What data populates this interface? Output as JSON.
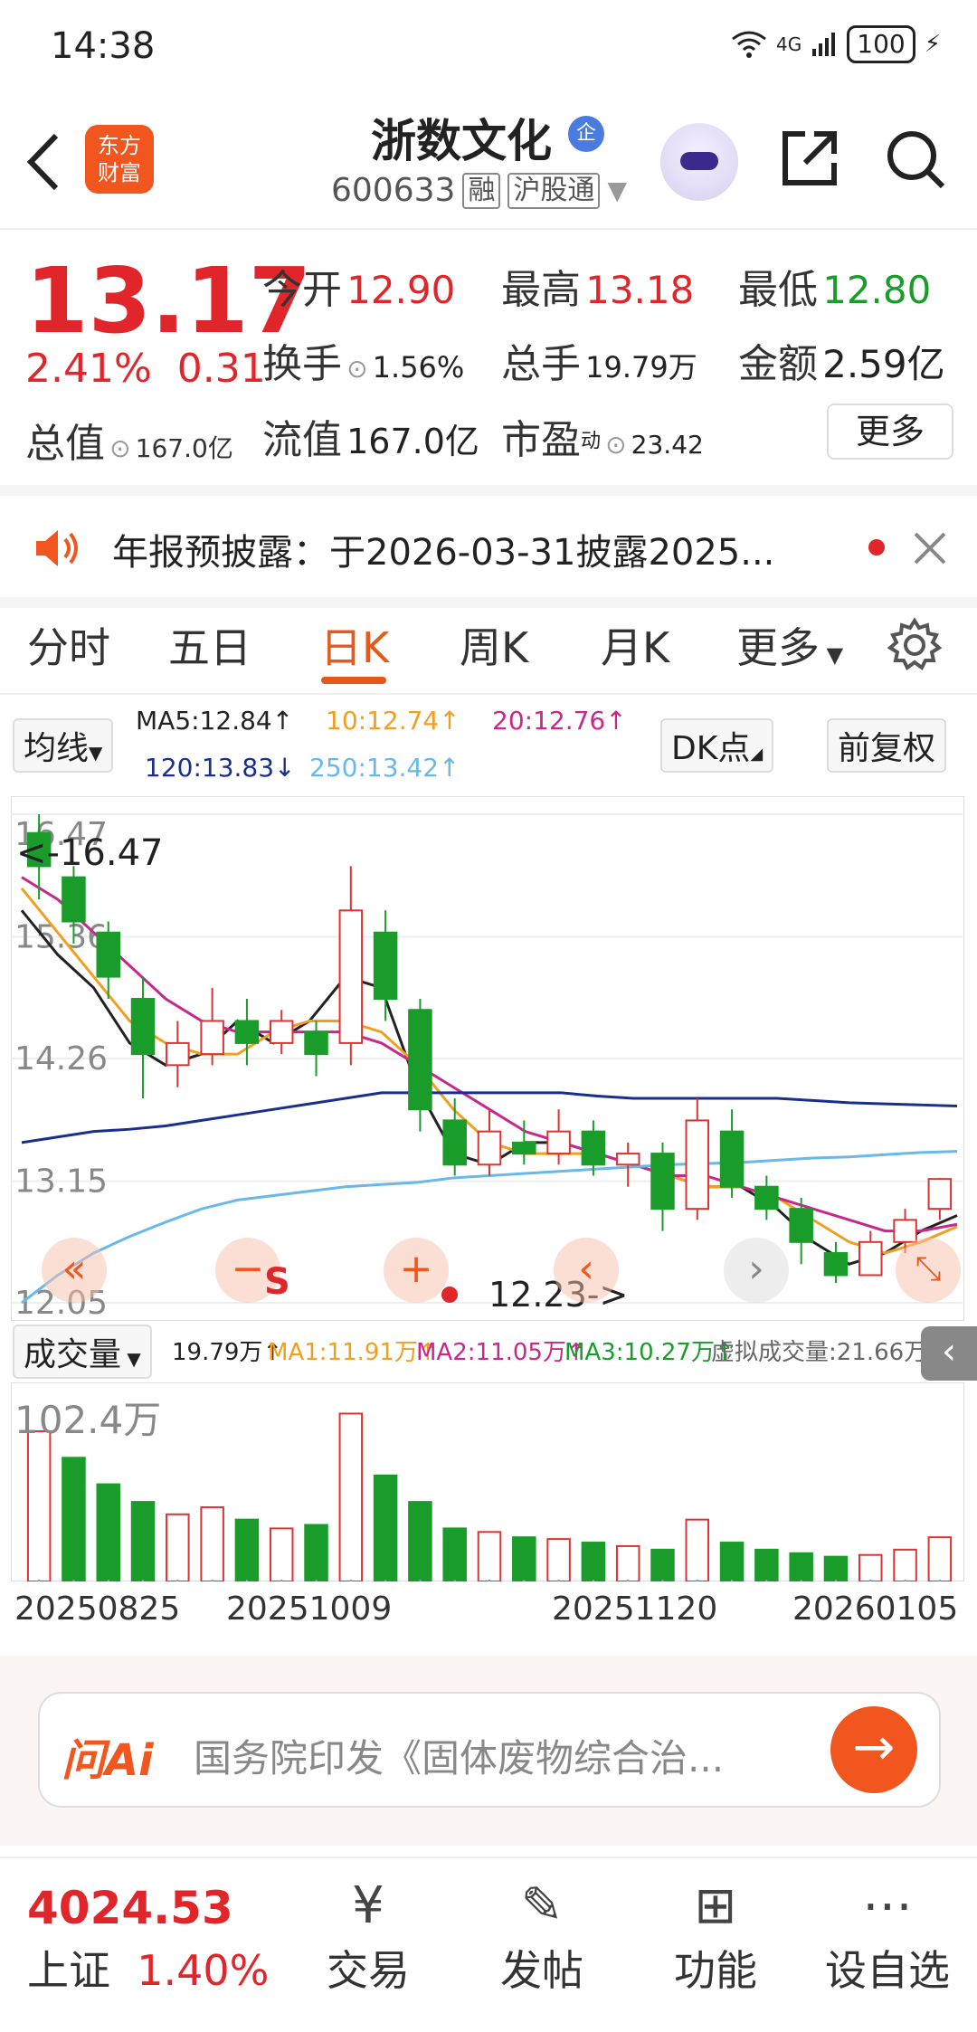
{
  "status": {
    "time": "14:38",
    "network": "4G",
    "battery": "100"
  },
  "header": {
    "logo_line1": "东方",
    "logo_line2": "财富",
    "name": "浙数文化",
    "badge": "企",
    "code": "600633",
    "tag1": "融",
    "tag2": "沪股通"
  },
  "quote": {
    "price": "13.17",
    "chg_pct": "2.41%",
    "chg": "0.31",
    "open_label": "今开",
    "open": "12.90",
    "high_label": "最高",
    "high": "13.18",
    "low_label": "最低",
    "low": "12.80",
    "turnover_label": "换手",
    "turnover": "1.56%",
    "volume_label": "总手",
    "volume": "19.79万",
    "amount_label": "金额",
    "amount": "2.59亿",
    "mktcap_label": "总值",
    "mktcap": "167.0亿",
    "float_label": "流值",
    "float": "167.0亿",
    "pe_label": "市盈",
    "pe_sup": "动",
    "pe": "23.42",
    "more": "更多"
  },
  "notice": {
    "text": "年报预披露：于2026-03-31披露2025..."
  },
  "tabs": [
    "分时",
    "五日",
    "日K",
    "周K",
    "月K",
    "更多"
  ],
  "ma_legend": {
    "btn": "均线",
    "ma5": "MA5:12.84↑",
    "ma10": "10:12.74↑",
    "ma20": "20:12.76↑",
    "ma120": "120:13.83↓",
    "ma250": "250:13.42↑",
    "dk": "DK点",
    "fq": "前复权",
    "colors": {
      "ma5": "#222222",
      "ma10": "#f0a020",
      "ma20": "#c8288c",
      "ma120": "#1a2f8c",
      "ma250": "#6ab8e8"
    }
  },
  "chart_data": {
    "type": "candlestick",
    "y_ticks": [
      "16.47",
      "15.36",
      "14.26",
      "13.15",
      "12.05"
    ],
    "max_label": "<-16.47",
    "min_label": "12.23->",
    "ylim": [
      12.05,
      16.47
    ],
    "series": [
      {
        "name": "MA5",
        "values": [
          15.6,
          15.2,
          14.9,
          14.4,
          14.2,
          14.3,
          14.6,
          14.4,
          14.6,
          15.0,
          14.9,
          14.0,
          13.4,
          13.3,
          13.5,
          13.5,
          13.4,
          13.3,
          13.2,
          13.1,
          13.1,
          12.9,
          12.6,
          12.4,
          12.5,
          12.7,
          12.84
        ]
      },
      {
        "name": "MA10",
        "values": [
          15.8,
          15.4,
          15.0,
          14.6,
          14.4,
          14.3,
          14.3,
          14.5,
          14.6,
          14.6,
          14.5,
          14.2,
          13.8,
          13.5,
          13.4,
          13.4,
          13.4,
          13.3,
          13.2,
          13.1,
          13.1,
          13.0,
          12.8,
          12.6,
          12.5,
          12.6,
          12.74
        ]
      },
      {
        "name": "MA20",
        "values": [
          15.9,
          15.7,
          15.4,
          15.1,
          14.8,
          14.6,
          14.5,
          14.5,
          14.5,
          14.5,
          14.4,
          14.2,
          14.0,
          13.8,
          13.6,
          13.5,
          13.4,
          13.3,
          13.2,
          13.2,
          13.1,
          13.0,
          12.9,
          12.8,
          12.7,
          12.7,
          12.76
        ]
      },
      {
        "name": "MA120",
        "values": [
          13.5,
          13.55,
          13.6,
          13.62,
          13.65,
          13.7,
          13.75,
          13.8,
          13.85,
          13.9,
          13.95,
          13.95,
          13.95,
          13.95,
          13.95,
          13.95,
          13.92,
          13.9,
          13.9,
          13.9,
          13.9,
          13.9,
          13.88,
          13.86,
          13.85,
          13.84,
          13.83
        ]
      },
      {
        "name": "MA250",
        "values": [
          12.05,
          12.3,
          12.5,
          12.65,
          12.78,
          12.9,
          12.98,
          13.02,
          13.06,
          13.1,
          13.12,
          13.14,
          13.18,
          13.2,
          13.22,
          13.24,
          13.26,
          13.28,
          13.3,
          13.31,
          13.32,
          13.34,
          13.36,
          13.37,
          13.39,
          13.41,
          13.42
        ]
      }
    ],
    "candles": [
      {
        "o": 16.3,
        "c": 16.0,
        "h": 16.47,
        "l": 15.7
      },
      {
        "o": 15.9,
        "c": 15.5,
        "h": 16.0,
        "l": 15.3
      },
      {
        "o": 15.4,
        "c": 15.0,
        "h": 15.5,
        "l": 14.8
      },
      {
        "o": 14.8,
        "c": 14.3,
        "h": 15.0,
        "l": 13.9
      },
      {
        "o": 14.2,
        "c": 14.4,
        "h": 14.6,
        "l": 14.0
      },
      {
        "o": 14.3,
        "c": 14.6,
        "h": 14.9,
        "l": 14.2
      },
      {
        "o": 14.6,
        "c": 14.4,
        "h": 14.8,
        "l": 14.2
      },
      {
        "o": 14.4,
        "c": 14.6,
        "h": 14.7,
        "l": 14.3
      },
      {
        "o": 14.5,
        "c": 14.3,
        "h": 14.6,
        "l": 14.1
      },
      {
        "o": 14.4,
        "c": 15.6,
        "h": 16.0,
        "l": 14.2
      },
      {
        "o": 15.4,
        "c": 14.8,
        "h": 15.6,
        "l": 14.6
      },
      {
        "o": 14.7,
        "c": 13.8,
        "h": 14.8,
        "l": 13.6
      },
      {
        "o": 13.7,
        "c": 13.3,
        "h": 13.9,
        "l": 13.2
      },
      {
        "o": 13.3,
        "c": 13.6,
        "h": 13.8,
        "l": 13.2
      },
      {
        "o": 13.5,
        "c": 13.4,
        "h": 13.7,
        "l": 13.3
      },
      {
        "o": 13.4,
        "c": 13.6,
        "h": 13.8,
        "l": 13.3
      },
      {
        "o": 13.6,
        "c": 13.3,
        "h": 13.7,
        "l": 13.2
      },
      {
        "o": 13.3,
        "c": 13.4,
        "h": 13.5,
        "l": 13.1
      },
      {
        "o": 13.4,
        "c": 12.9,
        "h": 13.5,
        "l": 12.7
      },
      {
        "o": 12.9,
        "c": 13.7,
        "h": 13.9,
        "l": 12.8
      },
      {
        "o": 13.6,
        "c": 13.1,
        "h": 13.8,
        "l": 13.0
      },
      {
        "o": 13.1,
        "c": 12.9,
        "h": 13.2,
        "l": 12.8
      },
      {
        "o": 12.9,
        "c": 12.6,
        "h": 13.0,
        "l": 12.4
      },
      {
        "o": 12.5,
        "c": 12.3,
        "h": 12.6,
        "l": 12.23
      },
      {
        "o": 12.3,
        "c": 12.6,
        "h": 12.7,
        "l": 12.3
      },
      {
        "o": 12.6,
        "c": 12.8,
        "h": 12.9,
        "l": 12.5
      },
      {
        "o": 12.9,
        "c": 13.17,
        "h": 13.18,
        "l": 12.8
      }
    ]
  },
  "volume": {
    "btn": "成交量",
    "vol": "19.79万↑",
    "ma1": "MA1:11.91万↑",
    "ma2": "MA2:11.05万↑",
    "ma3": "MA3:10.27万↑",
    "virtual": "虚拟成交量:21.66万",
    "max_label": "102.4万",
    "bars": [
      85,
      70,
      55,
      45,
      38,
      42,
      35,
      30,
      32,
      95,
      60,
      45,
      30,
      28,
      25,
      24,
      22,
      20,
      18,
      35,
      22,
      18,
      16,
      14,
      15,
      18,
      25
    ],
    "bar_up": [
      true,
      false,
      false,
      false,
      true,
      true,
      false,
      true,
      false,
      true,
      false,
      false,
      false,
      true,
      false,
      true,
      false,
      true,
      false,
      true,
      false,
      false,
      false,
      false,
      true,
      true,
      true
    ]
  },
  "dates": [
    "20250825",
    "20251009",
    "20251120",
    "20260105"
  ],
  "ai": {
    "logo": "问Ai",
    "text": "国务院印发《固体废物综合治..."
  },
  "bottom_nav": {
    "index_value": "4024.53",
    "index_name": "上证",
    "index_chg": "1.40%",
    "items": [
      {
        "label": "交易",
        "icon": "yen-icon"
      },
      {
        "label": "发帖",
        "icon": "edit-icon"
      },
      {
        "label": "功能",
        "icon": "grid-icon"
      },
      {
        "label": "设自选",
        "icon": "more-icon"
      }
    ]
  }
}
